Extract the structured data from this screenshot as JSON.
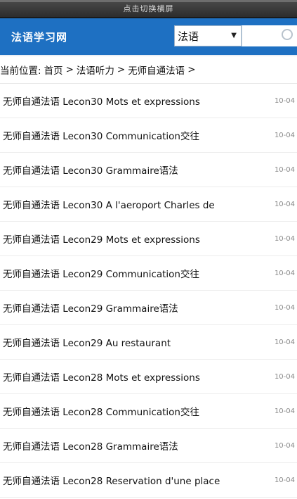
{
  "statusbar": {
    "text": "点击切换横屏"
  },
  "header": {
    "site_title": "法语学习网",
    "language_select": {
      "value": "法语",
      "caret": "▼"
    }
  },
  "breadcrumb": {
    "prefix": "当前位置:",
    "items": [
      "首页",
      "法语听力",
      "无师自通法语"
    ],
    "separator": ">"
  },
  "articles": [
    {
      "title": "无师自通法语 Lecon30 Mots et expressions",
      "date": "10-04"
    },
    {
      "title": "无师自通法语 Lecon30 Communication交往",
      "date": "10-04"
    },
    {
      "title": "无师自通法语 Lecon30 Grammaire语法",
      "date": "10-04"
    },
    {
      "title": "无师自通法语 Lecon30 A l'aeroport Charles de",
      "date": "10-04"
    },
    {
      "title": "无师自通法语 Lecon29 Mots et expressions",
      "date": "10-04"
    },
    {
      "title": "无师自通法语 Lecon29 Communication交往",
      "date": "10-04"
    },
    {
      "title": "无师自通法语 Lecon29 Grammaire语法",
      "date": "10-04"
    },
    {
      "title": "无师自通法语 Lecon29 Au restaurant",
      "date": "10-04"
    },
    {
      "title": "无师自通法语 Lecon28 Mots et expressions",
      "date": "10-04"
    },
    {
      "title": "无师自通法语 Lecon28 Communication交往",
      "date": "10-04"
    },
    {
      "title": "无师自通法语 Lecon28 Grammaire语法",
      "date": "10-04"
    },
    {
      "title": "无师自通法语 Lecon28 Reservation d'une place",
      "date": "10-04"
    }
  ],
  "colors": {
    "header_bg": "#1e70c2",
    "date_text": "#888888"
  }
}
